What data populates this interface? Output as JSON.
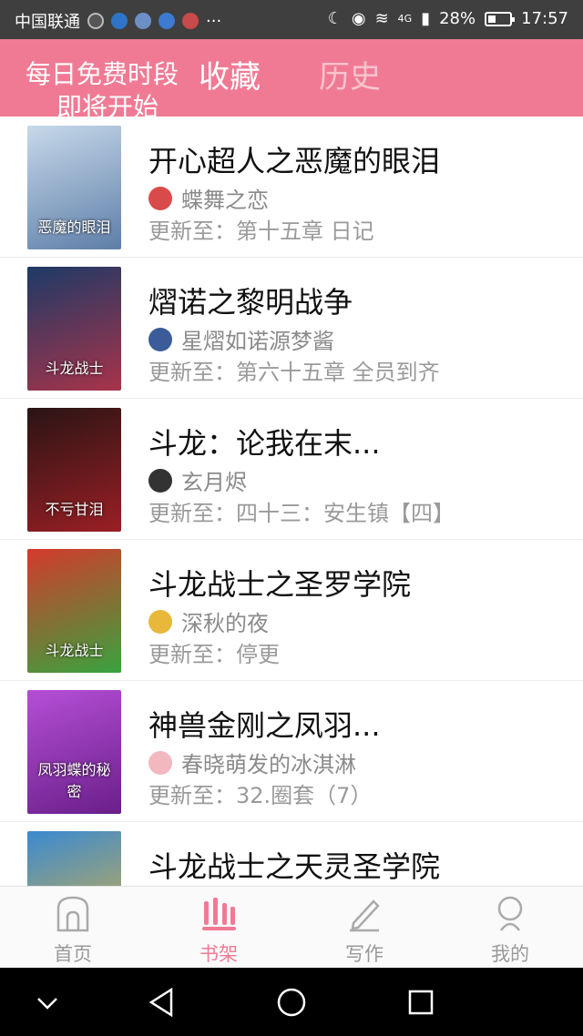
{
  "status_bar": {
    "carrier": "中国联通",
    "more": "···",
    "signal": "4G",
    "battery": "28%",
    "time": "17:57"
  },
  "header": {
    "free_slot_line1": "每日免费时段",
    "free_slot_line2": "即将开始",
    "tabs": [
      {
        "label": "收藏",
        "active": true
      },
      {
        "label": "历史",
        "active": false
      }
    ]
  },
  "books": [
    {
      "title": "开心超人之恶魔的眼泪",
      "author": "蝶舞之恋",
      "update": "更新至：第十五章   日记",
      "cover_text": "恶魔的眼泪",
      "cover_colors": [
        "#c7d9ea",
        "#5e7ea8"
      ],
      "avatar_color": "#d94b4b"
    },
    {
      "title": "熠诺之黎明战争",
      "author": "星熠如诺源梦酱",
      "update": "更新至：第六十五章  全员到齐",
      "cover_text": "斗龙战士",
      "cover_colors": [
        "#1d3a66",
        "#a8334a"
      ],
      "avatar_color": "#3b5c99"
    },
    {
      "title": "斗龙：论我在末...",
      "author": "玄月烬",
      "update": "更新至：四十三：安生镇【四】",
      "cover_text": "不亏甘泪",
      "cover_colors": [
        "#2a1414",
        "#9a1f25"
      ],
      "avatar_color": "#333333"
    },
    {
      "title": "斗龙战士之圣罗学院",
      "author": "深秋的夜",
      "update": "更新至：停更",
      "cover_text": "斗龙战士",
      "cover_colors": [
        "#d43a2b",
        "#38a33e"
      ],
      "avatar_color": "#e8b83a"
    },
    {
      "title": "神兽金刚之凤羽...",
      "author": "春晓萌发的冰淇淋",
      "update": "更新至：32.圈套（7）",
      "cover_text": "凤羽蝶的秘密",
      "cover_colors": [
        "#b54fd6",
        "#6a1f8a"
      ],
      "avatar_color": "#f2b8c0"
    },
    {
      "title": "斗龙战士之天灵圣学院",
      "author": "",
      "update": "",
      "cover_text": "",
      "cover_colors": [
        "#3a8ad1",
        "#e0b33b"
      ],
      "avatar_color": "#ffffff"
    }
  ],
  "bottom_nav": [
    {
      "label": "首页",
      "icon": "home-icon",
      "active": false
    },
    {
      "label": "书架",
      "icon": "bookshelf-icon",
      "active": true
    },
    {
      "label": "写作",
      "icon": "pencil-icon",
      "active": false
    },
    {
      "label": "我的",
      "icon": "profile-icon",
      "active": false
    }
  ],
  "colors": {
    "brand": "#f07a94",
    "inactive": "#999999"
  }
}
